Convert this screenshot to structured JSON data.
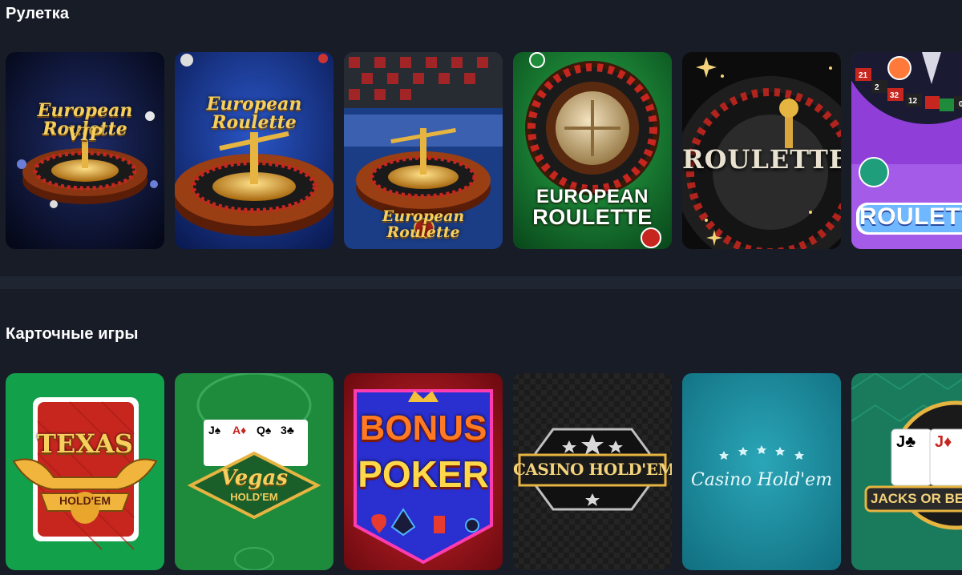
{
  "sections": [
    {
      "title": "Рулетка",
      "games": [
        {
          "name": "European Roulette VIP",
          "line1": "European Roulette",
          "line2": "VIP"
        },
        {
          "name": "European Roulette",
          "line1": "European Roulette"
        },
        {
          "name": "European Roulette",
          "line1": "European Roulette"
        },
        {
          "name": "European Roulette",
          "line1": "EUROPEAN",
          "line2": "ROULETTE"
        },
        {
          "name": "RouletteX",
          "line1": "ROULETTEX"
        },
        {
          "name": "Roulette",
          "line1": "ROULETTE"
        }
      ]
    },
    {
      "title": "Карточные игры",
      "games": [
        {
          "name": "Texas Hold'em",
          "line1": "TEXAS",
          "line2": "HOLD'EM"
        },
        {
          "name": "Vegas Hold'em",
          "line1": "Vegas",
          "line2": "HOLD'EM"
        },
        {
          "name": "Bonus Poker",
          "line1": "BONUS",
          "line2": "POKER"
        },
        {
          "name": "Casino Hold'em",
          "line1": "CASINO HOLD'EM"
        },
        {
          "name": "Casino Hold'em",
          "line1": "Casino Hold'em"
        },
        {
          "name": "Jacks or Better",
          "line1": "JACKS OR BETTER"
        }
      ]
    }
  ]
}
